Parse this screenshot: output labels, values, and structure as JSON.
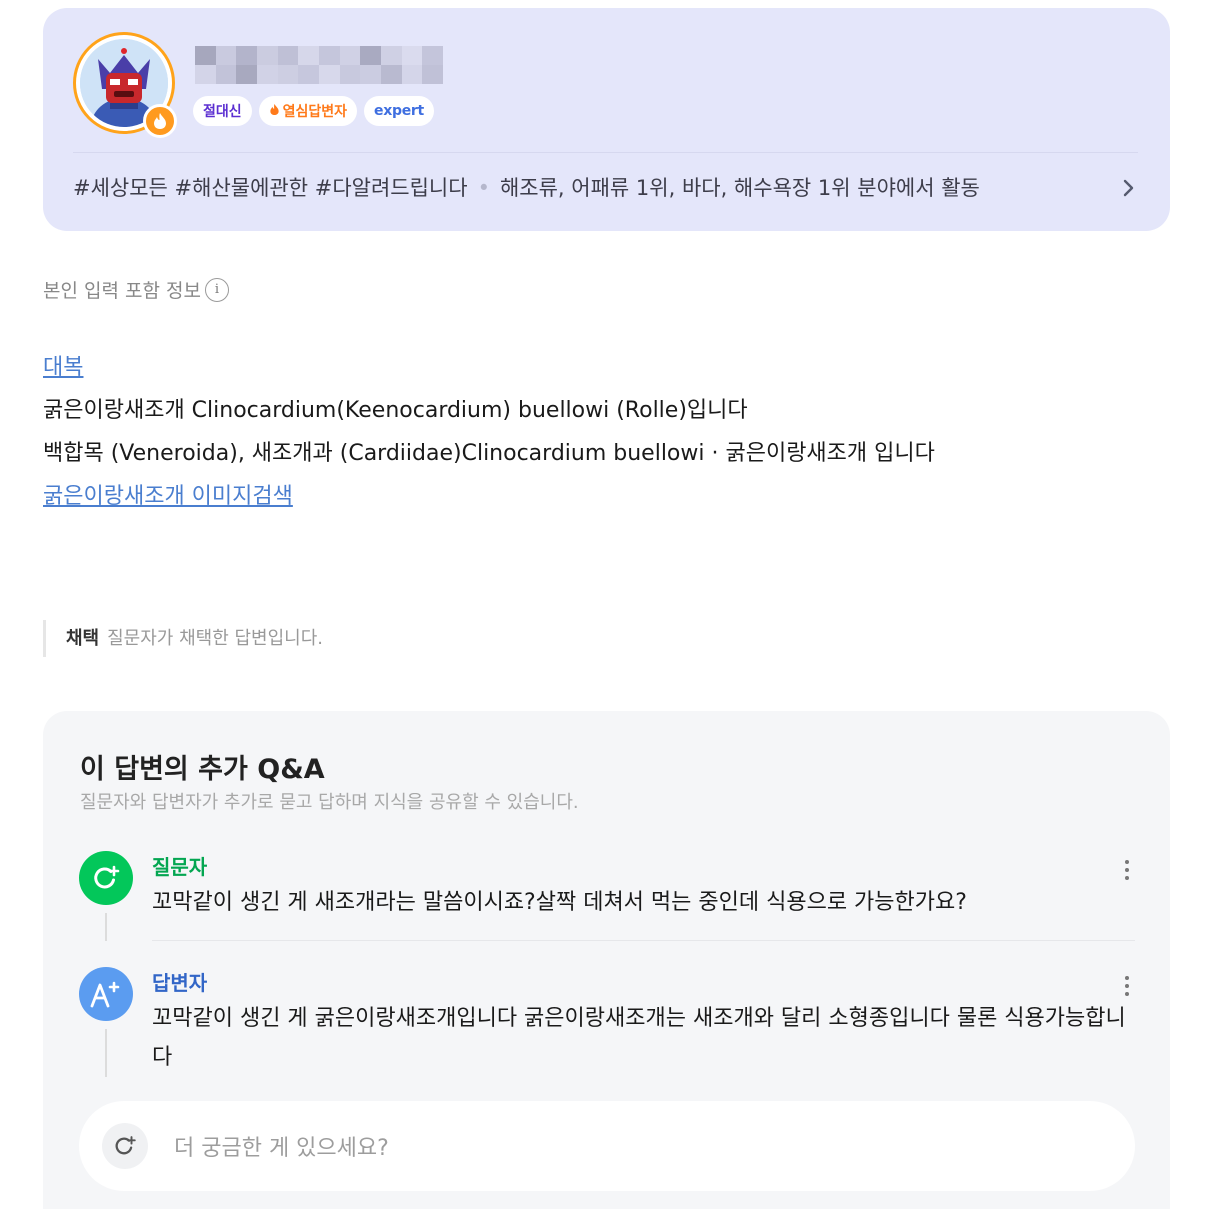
{
  "profile": {
    "badges": [
      {
        "label": "절대신"
      },
      {
        "label": "열심답변자"
      },
      {
        "label": "expert"
      }
    ],
    "description": {
      "tags": "#세상모든 #해산물에관한 #다알려드립니다",
      "rank": "해조류, 어패류 1위, 바다, 해수욕장 1위 분야에서 활동"
    },
    "colors": {
      "card_bg": "#e4e6fa",
      "avatar_ring": "#ffa31a"
    }
  },
  "info_label": "본인 입력 포함 정보",
  "answer": {
    "link_top": "대복 ",
    "line1": "굵은이랑새조개 Clinocardium(Keenocardium) buellowi (Rolle)입니다",
    "line2": "백합목 (Veneroida), 새조개과 (Cardiidae)Clinocardium buellowi · 굵은이랑새조개 입니다",
    "link_bottom": "굵은이랑새조개 이미지검색"
  },
  "accepted": {
    "tag": "채택",
    "text": "질문자가 채택한 답변입니다."
  },
  "qa": {
    "title": "이 답변의 추가 Q&A",
    "subtitle": "질문자와 답변자가 추가로 묻고 답하며 지식을 공유할 수 있습니다.",
    "entries": [
      {
        "role": "질문자",
        "text": "꼬막같이 생긴 게 새조개라는 말씀이시죠?살짝 데쳐서 먹는 중인데 식용으로 가능한가요?",
        "color": "#03c75a"
      },
      {
        "role": "답변자",
        "text": "꼬막같이 생긴 게 굵은이랑새조개입니다 굵은이랑새조개는 새조개와 달리 소형종입니다 물론 식용가능합니다",
        "color": "#5b9cf0"
      }
    ],
    "ask_placeholder": "더 궁금한 게 있으세요?"
  }
}
